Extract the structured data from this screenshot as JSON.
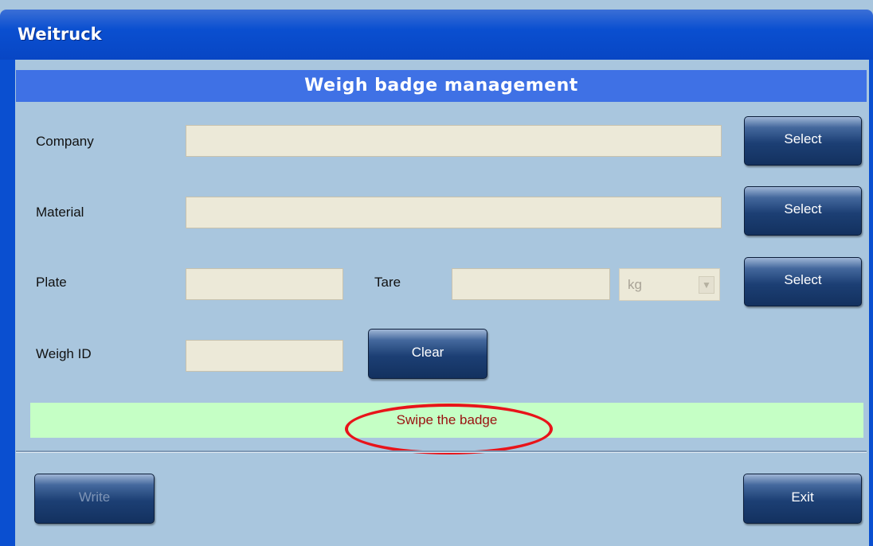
{
  "window": {
    "title": "Weitruck"
  },
  "header": {
    "title": "Weigh badge management"
  },
  "form": {
    "company": {
      "label": "Company",
      "value": "",
      "select_label": "Select"
    },
    "material": {
      "label": "Material",
      "value": "",
      "select_label": "Select"
    },
    "plate": {
      "label": "Plate",
      "value": ""
    },
    "tare": {
      "label": "Tare",
      "value": "",
      "unit": "kg",
      "select_label": "Select"
    },
    "weigh_id": {
      "label": "Weigh ID",
      "value": ""
    },
    "clear_label": "Clear"
  },
  "status": {
    "message": "Swipe the badge",
    "background": "#c5ffc5",
    "text_color": "#9a1010"
  },
  "annotation": {
    "color": "#e8141a"
  },
  "footer": {
    "write_label": "Write",
    "exit_label": "Exit"
  },
  "colors": {
    "titlebar": "#0a4fd0",
    "header_bar": "#3f71e5",
    "panel": "#a9c6de",
    "field": "#ece9d8"
  }
}
